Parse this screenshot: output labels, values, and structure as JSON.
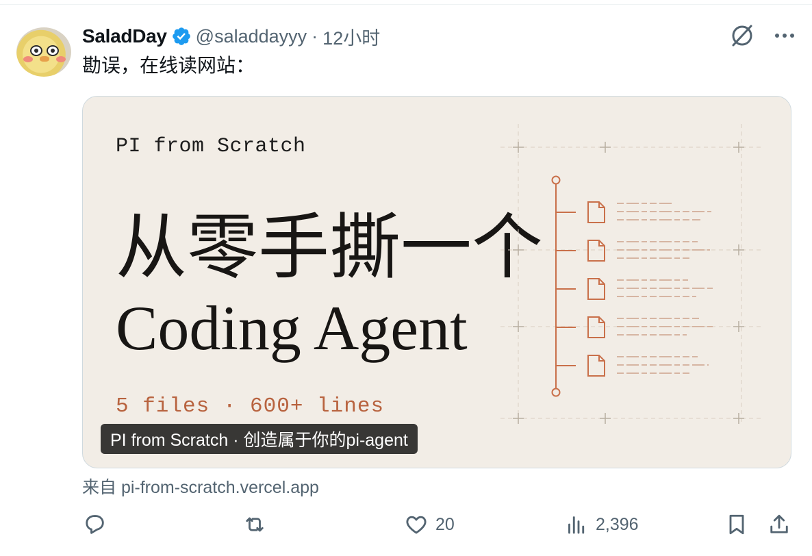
{
  "tweet": {
    "display_name": "SaladDay",
    "handle": "@saladdayyy",
    "separator": "·",
    "time": "12小时",
    "text": "勘误，在线读网站："
  },
  "card": {
    "small_title": "PI from Scratch",
    "big_title_line1": "从零手撕一个",
    "big_title_line2": "Coding Agent",
    "stats": "5 files  ·  600+ lines",
    "caption": "PI from Scratch · 创造属于你的pi-agent",
    "source": "来自 pi-from-scratch.vercel.app"
  },
  "actions": {
    "reply_count": "",
    "retweet_count": "",
    "like_count": "20",
    "views_count": "2,396"
  },
  "icons": [
    "grok-icon",
    "more-icon",
    "verified-badge-icon",
    "reply-icon",
    "retweet-icon",
    "like-icon",
    "views-icon",
    "bookmark-icon",
    "share-icon"
  ],
  "colors": {
    "accent": "#1d9bf0",
    "muted": "#536471",
    "card_bg": "#f2ede6",
    "card_orange": "#b8633f"
  }
}
